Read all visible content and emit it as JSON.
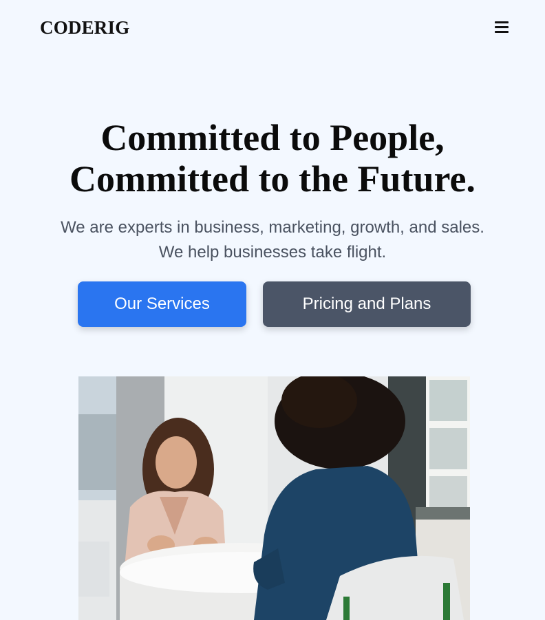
{
  "header": {
    "logo": "CODERIG",
    "menu_icon": "hamburger-menu-icon"
  },
  "hero": {
    "title_line1": "Committed to People,",
    "title_line2": "Committed to the Future.",
    "subtitle_line1": "We are experts in business, marketing, growth, and sales.",
    "subtitle_line2": "We help businesses take flight.",
    "primary_button": "Our Services",
    "secondary_button": "Pricing and Plans"
  },
  "colors": {
    "background": "#f3f8ff",
    "primary": "#2a75f0",
    "secondary": "#4b5567"
  },
  "image": {
    "subject": "two women having a conversation at a white round table by a window"
  }
}
